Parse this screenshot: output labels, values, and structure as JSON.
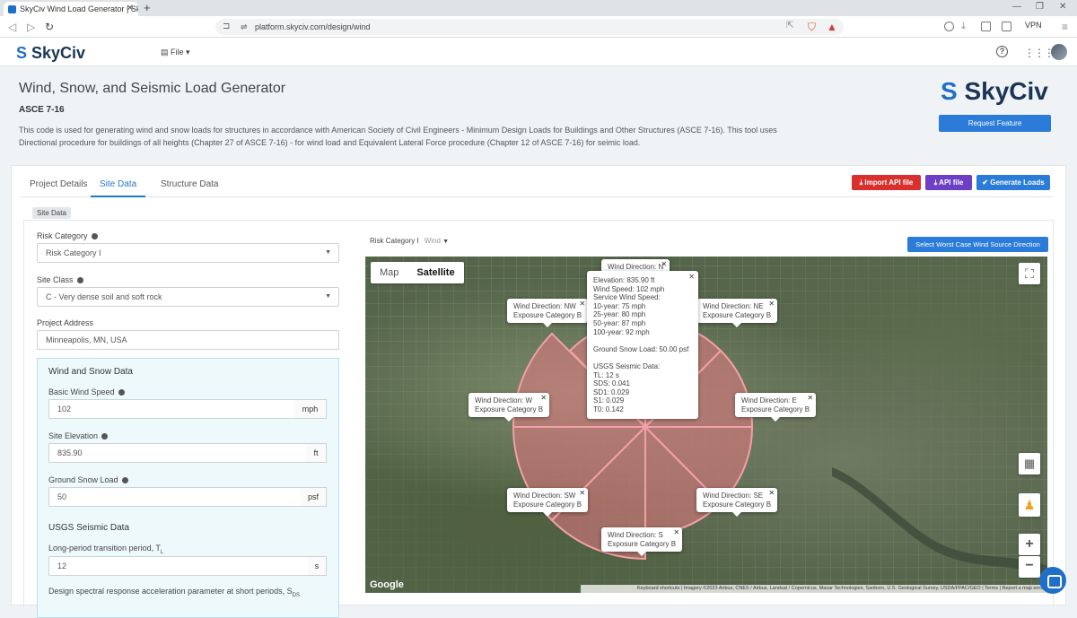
{
  "browser": {
    "tab_title": "SkyCiv Wind Load Generator | Sk",
    "url": "platform.skyciv.com/design/wind",
    "vpn_label": "VPN"
  },
  "appbar": {
    "logo": "SkyCiv",
    "file_menu": "File"
  },
  "header": {
    "title": "Wind, Snow, and Seismic Load Generator",
    "standard": "ASCE 7-16",
    "description": "This code is used for generating wind and snow loads for structures in accordance with American Society of Civil Engineers - Minimum Design Loads for Buildings and Other Structures (ASCE 7-16). This tool uses Directional procedure for buildings of all heights (Chapter 27 of ASCE 7-16) - for wind load and Equivalent Lateral Force procedure (Chapter 12 of ASCE 7-16) for seimic load.",
    "logo": "SkyCiv",
    "request_feature": "Request Feature"
  },
  "tabs": [
    "Project Details",
    "Site Data",
    "Structure Data"
  ],
  "actions": {
    "import_api": "Import API file",
    "api_file": "API file",
    "generate": "Generate Loads"
  },
  "site_label": "Site Data",
  "form": {
    "risk_category_label": "Risk Category",
    "risk_category_value": "Risk Category I",
    "site_class_label": "Site Class",
    "site_class_value": "C - Very dense soil and soft rock",
    "address_label": "Project Address",
    "address_value": "Minneapolis, MN, USA",
    "ws_heading": "Wind and Snow Data",
    "wind_speed_label": "Basic Wind Speed",
    "wind_speed_value": "102",
    "wind_speed_unit": "mph",
    "elevation_label": "Site Elevation",
    "elevation_value": "835.90",
    "elevation_unit": "ft",
    "snow_label": "Ground Snow Load",
    "snow_value": "50",
    "snow_unit": "psf",
    "usgs_heading": "USGS Seismic Data",
    "tl_label": "Long-period transition period, T",
    "tl_sub": "L",
    "tl_value": "12",
    "tl_unit": "s",
    "sds_label": "Design spectral response acceleration parameter at short periods, S",
    "sds_sub": "DS"
  },
  "map": {
    "risk_label": "Risk Category I",
    "risk_wind": "Wind",
    "worst_case_button": "Select Worst Case Wind Source Direction",
    "type_map": "Map",
    "type_satellite": "Satellite",
    "popups": {
      "n": [
        "Wind Direction: N"
      ],
      "nw": [
        "Wind Direction: NW",
        "Exposure Category B"
      ],
      "ne": [
        "Wind Direction: NE",
        "Exposure Category B"
      ],
      "w": [
        "Wind Direction: W",
        "Exposure Category B"
      ],
      "e": [
        "Wind Direction: E",
        "Exposure Category B"
      ],
      "sw": [
        "Wind Direction: SW",
        "Exposure Category B"
      ],
      "se": [
        "Wind Direction: SE",
        "Exposure Category B"
      ],
      "s": [
        "Wind Direction: S",
        "Exposure Category B"
      ]
    },
    "info": [
      "Elevation: 835.90 ft",
      "Wind Speed: 102 mph",
      "Service Wind Speed:",
      "10-year: 75 mph",
      "25-year: 80 mph",
      "50-year: 87 mph",
      "100-year: 92 mph",
      "",
      "Ground Snow Load: 50.00 psf",
      "",
      "USGS Seismic Data:",
      "TL: 12 s",
      "SDS: 0.041",
      "SD1: 0.029",
      "S1: 0.029",
      "T0: 0.142"
    ],
    "google": "Google",
    "attribution": "Keyboard shortcuts | Imagery ©2023 Airbus, CNES / Airbus, Landsat / Copernicus, Maxar Technologies, Sanborn, U.S. Geological Survey, USDA/FPAC/GEO | Terms | Report a map error"
  }
}
